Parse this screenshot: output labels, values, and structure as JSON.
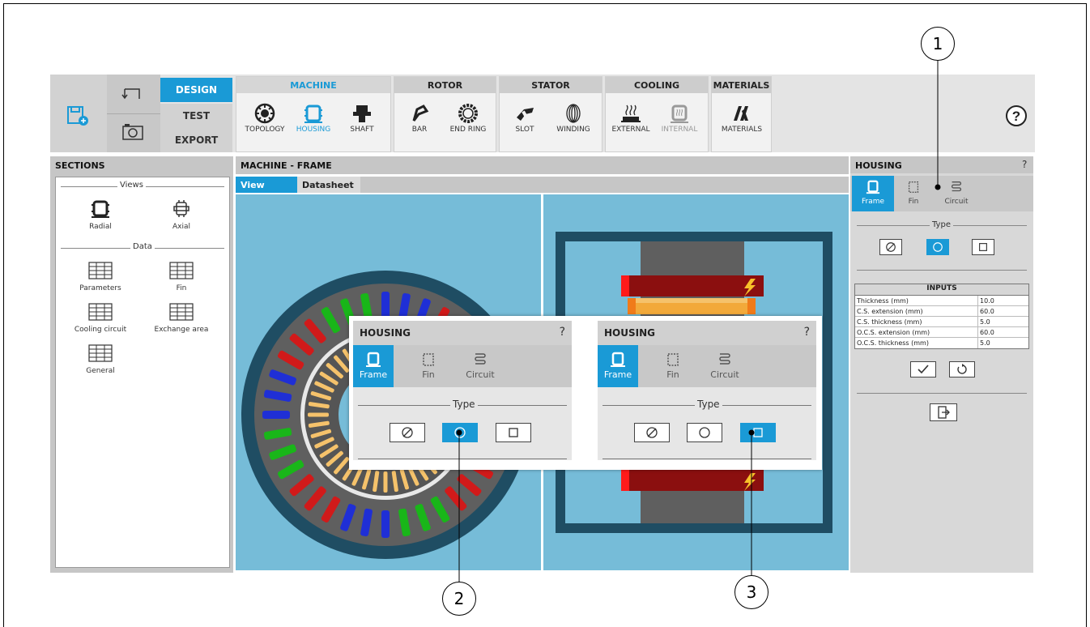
{
  "toolbar": {
    "modes": [
      "DESIGN",
      "TEST",
      "EXPORT"
    ],
    "groups": [
      {
        "title": "MACHINE",
        "tools": [
          "TOPOLOGY",
          "HOUSING",
          "SHAFT"
        ]
      },
      {
        "title": "ROTOR",
        "tools": [
          "BAR",
          "END RING"
        ]
      },
      {
        "title": "STATOR",
        "tools": [
          "SLOT",
          "WINDING"
        ]
      },
      {
        "title": "COOLING",
        "tools": [
          "EXTERNAL",
          "INTERNAL"
        ]
      },
      {
        "title": "MATERIALS",
        "tools": [
          "MATERIALS"
        ]
      }
    ],
    "help": "?"
  },
  "sections": {
    "title": "SECTIONS",
    "views_label": "Views",
    "views": [
      "Radial",
      "Axial"
    ],
    "data_label": "Data",
    "data_items": [
      "Parameters",
      "Fin",
      "Cooling circuit",
      "Exchange area",
      "General"
    ]
  },
  "center": {
    "title": "MACHINE - FRAME",
    "tabs": [
      "View",
      "Datasheet"
    ]
  },
  "housing_panel": {
    "title": "HOUSING",
    "help": "?",
    "tabs": [
      "Frame",
      "Fin",
      "Circuit"
    ],
    "type_label": "Type",
    "inputs_title": "INPUTS",
    "inputs": [
      {
        "label": "Thickness (mm)",
        "value": "10.0"
      },
      {
        "label": "C.S. extension (mm)",
        "value": "60.0"
      },
      {
        "label": "C.S. thickness (mm)",
        "value": "5.0"
      },
      {
        "label": "O.C.S. extension (mm)",
        "value": "60.0"
      },
      {
        "label": "O.C.S. thickness (mm)",
        "value": "5.0"
      }
    ]
  },
  "popup_left": {
    "title": "HOUSING",
    "help": "?",
    "tabs": [
      "Frame",
      "Fin",
      "Circuit"
    ],
    "type_label": "Type"
  },
  "popup_right": {
    "title": "HOUSING",
    "help": "?",
    "tabs": [
      "Frame",
      "Fin",
      "Circuit"
    ],
    "type_label": "Type"
  },
  "callouts": [
    "1",
    "2",
    "3"
  ],
  "colors": {
    "accent": "#1a9ad6",
    "canvas": "#76bcd8"
  }
}
